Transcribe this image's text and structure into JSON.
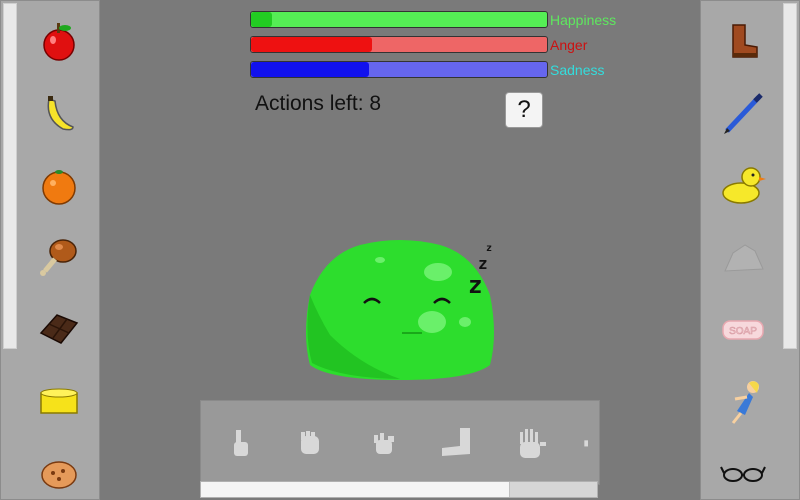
{
  "meters": [
    {
      "label": "Happiness",
      "value": 0.07,
      "color": "#55ee55",
      "fill": "#22cc22",
      "label_color": "#5ee85e"
    },
    {
      "label": "Anger",
      "value": 0.41,
      "color": "#ee6666",
      "fill": "#ee1111",
      "label_color": "#cc1111"
    },
    {
      "label": "Sadness",
      "value": 0.4,
      "color": "#6666ee",
      "fill": "#1111ee",
      "label_color": "#33dddd"
    }
  ],
  "actions_left": "Actions left: 8",
  "help_label": "?",
  "left_items": [
    "apple",
    "banana",
    "orange",
    "drumstick",
    "chocolate",
    "cheese",
    "cookie"
  ],
  "right_items": [
    "boot",
    "pen",
    "rubber-duck",
    "rock",
    "soap",
    "doll",
    "glasses"
  ],
  "soap_text": "SOAP",
  "interactions": [
    "point-hand",
    "grab-hand",
    "tickle-hand",
    "kick-foot",
    "wave-hand"
  ],
  "creature": {
    "state": "sleeping",
    "sleep_glyph": "z"
  },
  "tray_scroll_fraction": 0.78
}
